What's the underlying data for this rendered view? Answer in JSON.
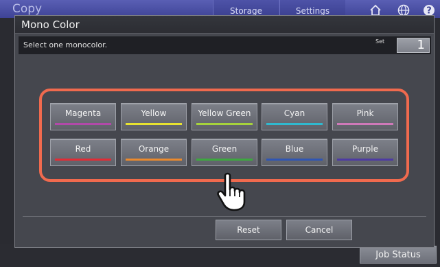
{
  "app": {
    "title": "Copy",
    "tabs": [
      "Storage",
      "Settings"
    ],
    "job_status_label": "Job Status"
  },
  "dialog": {
    "title": "Mono Color",
    "instruction": "Select one monocolor.",
    "set_label": "Set",
    "set_value": "1"
  },
  "colors": [
    {
      "label": "Magenta",
      "swatch": "#b249a9"
    },
    {
      "label": "Yellow",
      "swatch": "#e7e230"
    },
    {
      "label": "Yellow Green",
      "swatch": "#a6d23c"
    },
    {
      "label": "Cyan",
      "swatch": "#2fb9cf"
    },
    {
      "label": "Pink",
      "swatch": "#cf79b9"
    },
    {
      "label": "Red",
      "swatch": "#e32b35"
    },
    {
      "label": "Orange",
      "swatch": "#ec8a2d"
    },
    {
      "label": "Green",
      "swatch": "#3da83f"
    },
    {
      "label": "Blue",
      "swatch": "#2f55b4"
    },
    {
      "label": "Purple",
      "swatch": "#4d3aa3"
    }
  ],
  "actions": {
    "reset_label": "Reset",
    "cancel_label": "Cancel"
  },
  "theme": {
    "highlight_color": "#f06a4e",
    "header_color": "#4a4fa6"
  },
  "icons": [
    "home-icon",
    "globe-icon",
    "help-icon",
    "hand-pointer-icon"
  ]
}
